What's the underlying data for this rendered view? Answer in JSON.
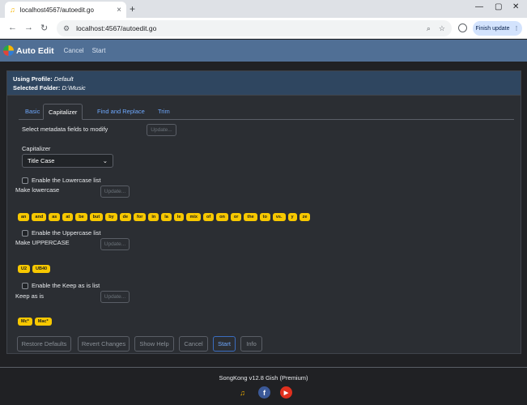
{
  "browser": {
    "tab_title": "localhost4567/autoedit.go",
    "url": "localhost:4567/autoedit.go",
    "finish_update": "Finish update"
  },
  "app": {
    "title": "Auto Edit",
    "nav": [
      "Cancel",
      "Start"
    ]
  },
  "panel": {
    "profile_label": "Using Profile:",
    "profile_value": "Default",
    "folder_label": "Selected Folder:",
    "folder_value": "D:\\Music"
  },
  "tabs": [
    "Basic",
    "Capitalizer",
    "Find and Replace",
    "Trim"
  ],
  "active_tab": "Capitalizer",
  "capitalizer": {
    "select_fields_label": "Select metadata fields to modify",
    "update_button": "Update...",
    "capitalizer_label": "Capitalizer",
    "capitalizer_value": "Title Case",
    "lowercase_enable": "Enable the Lowercase list",
    "lowercase_label": "Make lowercase",
    "lowercase_words": [
      "an",
      "and",
      "as",
      "at",
      "be",
      "but",
      "by",
      "de",
      "for",
      "in",
      "la",
      "le",
      "mix",
      "of",
      "on",
      "or",
      "the",
      "to",
      "vs.",
      "y",
      "ze"
    ],
    "uppercase_enable": "Enable the Uppercase list",
    "uppercase_label": "Make UPPERCASE",
    "uppercase_words": [
      "U2",
      "UB40"
    ],
    "keep_enable": "Enable the Keep as is list",
    "keep_label": "Keep as is",
    "keep_words": [
      "Mc*",
      "Mac*"
    ]
  },
  "buttons": {
    "restore": "Restore Defaults",
    "revert": "Revert Changes",
    "help": "Show Help",
    "cancel": "Cancel",
    "start": "Start",
    "info": "Info"
  },
  "footer": {
    "text": "SongKong v12.8 Gish (Premium)"
  },
  "icons": {
    "logo": "songkong-logo-icon",
    "social": [
      "songkong-icon",
      "facebook-icon",
      "youtube-icon"
    ]
  },
  "colors": {
    "header_bg": "#506f95",
    "panel_head_bg": "#2f4660",
    "chip": "#f7c800",
    "link": "#6ea8fe"
  }
}
